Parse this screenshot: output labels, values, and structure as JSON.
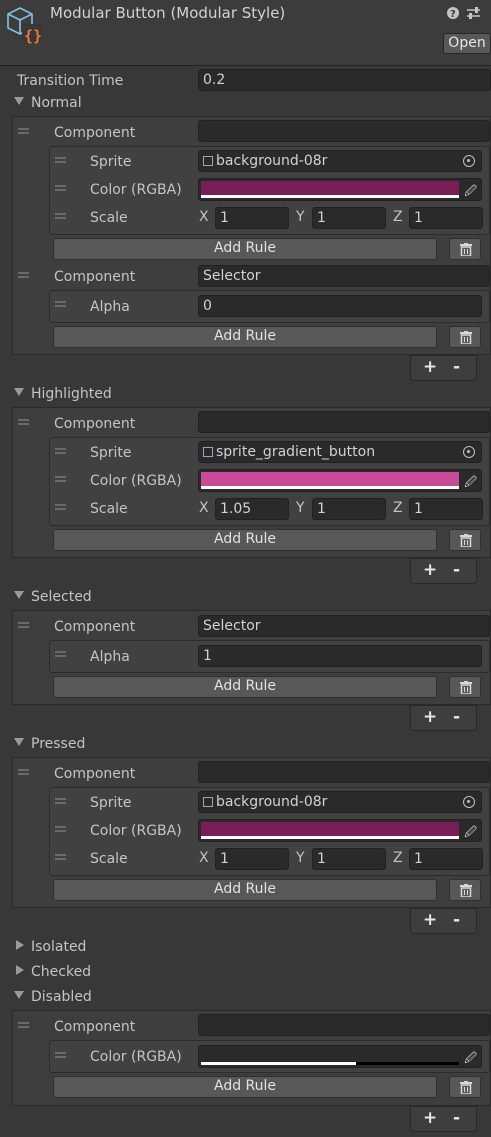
{
  "header": {
    "title": "Modular Button (Modular Style)",
    "open_label": "Open",
    "help_icon": "help-icon",
    "settings_icon": "settings-sliders-icon"
  },
  "transition_time": {
    "label": "Transition Time",
    "value": "0.2"
  },
  "labels": {
    "component": "Component",
    "sprite": "Sprite",
    "color": "Color (RGBA)",
    "scale": "Scale",
    "alpha": "Alpha",
    "add_rule": "Add Rule",
    "x": "X",
    "y": "Y",
    "z": "Z",
    "plus": "+",
    "minus": "-"
  },
  "states": {
    "normal": {
      "label": "Normal",
      "c1": {
        "component": "",
        "sprite": "background-08r",
        "color": "#7a1e57",
        "scale": [
          "1",
          "1",
          "1"
        ]
      },
      "c2": {
        "component": "Selector",
        "alpha": "0"
      }
    },
    "highlighted": {
      "label": "Highlighted",
      "c1": {
        "component": "",
        "sprite": "sprite_gradient_button",
        "color": "#c94a96",
        "scale": [
          "1.05",
          "1",
          "1"
        ]
      }
    },
    "selected": {
      "label": "Selected",
      "c1": {
        "component": "Selector",
        "alpha": "1"
      }
    },
    "pressed": {
      "label": "Pressed",
      "c1": {
        "component": "",
        "sprite": "background-08r",
        "color": "#7a1e57",
        "scale": [
          "1",
          "1",
          "1"
        ]
      }
    },
    "isolated": {
      "label": "Isolated"
    },
    "checked": {
      "label": "Checked"
    },
    "disabled": {
      "label": "Disabled",
      "c1": {
        "component": "",
        "color": "#ffffff",
        "alpha_fraction": 0.6
      }
    }
  },
  "colors": {
    "background": "#383838",
    "panel": "#3e3e3e",
    "field": "#2a2a2a"
  }
}
